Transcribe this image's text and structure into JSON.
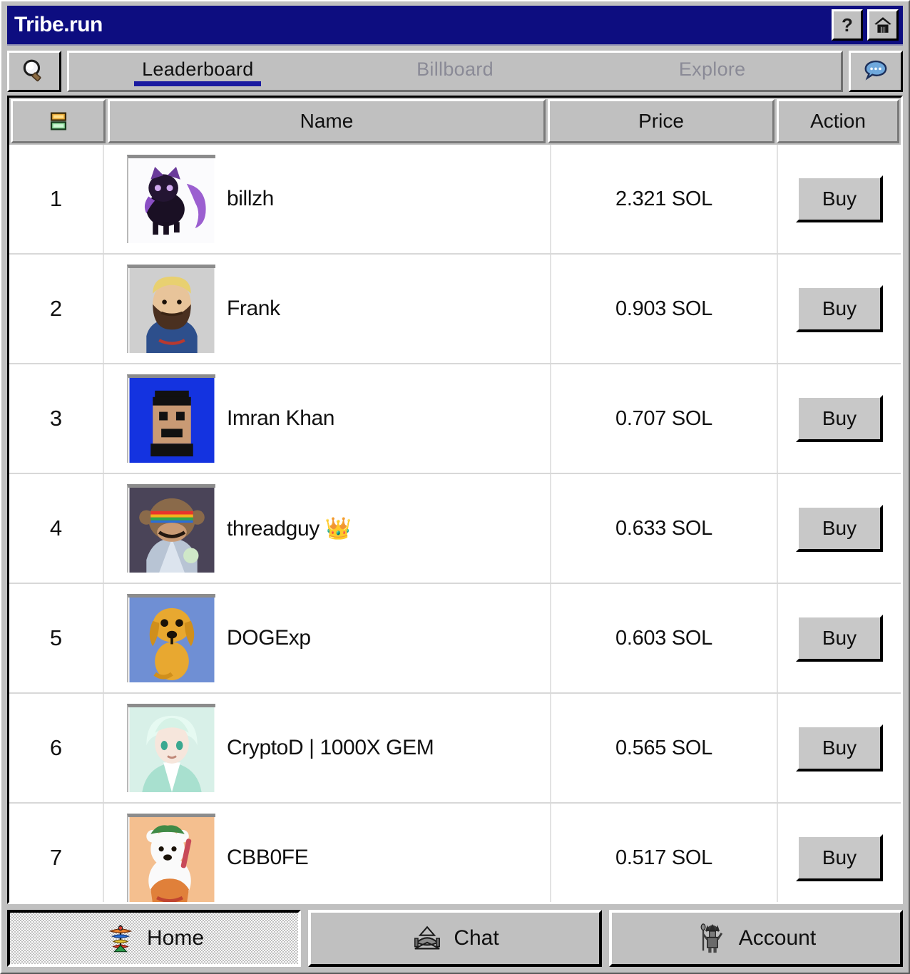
{
  "window": {
    "title": "Tribe.run",
    "title_bar_color": "#0d0d80",
    "face_color": "#c0c0c0",
    "help_button_glyph": "?",
    "help_button_name": "help-button",
    "home_button_name": "home-button"
  },
  "toolbar": {
    "search_icon": "search-icon",
    "chat_icon": "chat-bubble-icon",
    "tabs": [
      {
        "label": "Leaderboard",
        "active": true
      },
      {
        "label": "Billboard",
        "active": false
      },
      {
        "label": "Explore",
        "active": false
      }
    ],
    "active_underline_color": "#1a1aa0"
  },
  "table": {
    "columns": {
      "rank_icon": "stacked-cards-icon",
      "name": "Name",
      "price": "Price",
      "action": "Action"
    },
    "rows": [
      {
        "rank": "1",
        "name": "billzh",
        "price": "2.321 SOL",
        "action": "Buy",
        "avatar": "purple-cat-avatar"
      },
      {
        "rank": "2",
        "name": "Frank",
        "price": "0.903 SOL",
        "action": "Buy",
        "avatar": "bearded-man-avatar"
      },
      {
        "rank": "3",
        "name": "Imran Khan",
        "price": "0.707 SOL",
        "action": "Buy",
        "avatar": "blue-pixel-man-avatar"
      },
      {
        "rank": "4",
        "name": "threadguy 👑",
        "price": "0.633 SOL",
        "action": "Buy",
        "avatar": "rainbow-monkey-avatar"
      },
      {
        "rank": "5",
        "name": "DOGExp",
        "price": "0.603 SOL",
        "action": "Buy",
        "avatar": "yellow-dog-avatar"
      },
      {
        "rank": "6",
        "name": "CryptoD | 1000X GEM",
        "price": "0.565 SOL",
        "action": "Buy",
        "avatar": "mint-anime-avatar"
      },
      {
        "rank": "7",
        "name": "CBB0FE",
        "price": "0.517 SOL",
        "action": "Buy",
        "avatar": "peach-bear-avatar"
      }
    ]
  },
  "bottom_nav": [
    {
      "label": "Home",
      "icon": "tribal-totem-icon",
      "active": true
    },
    {
      "label": "Chat",
      "icon": "tribal-drum-icon",
      "active": false
    },
    {
      "label": "Account",
      "icon": "tribal-warrior-icon",
      "active": false
    }
  ]
}
